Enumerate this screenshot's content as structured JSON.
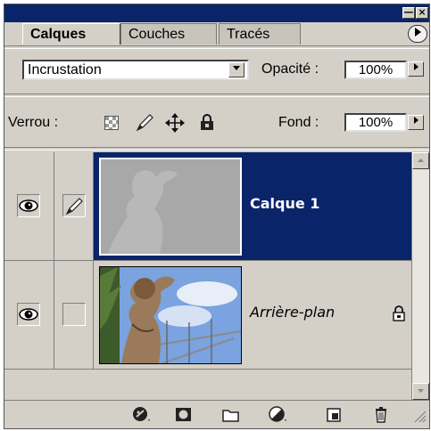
{
  "window": {
    "minimize_glyph": "—",
    "close_glyph": "×"
  },
  "tabs": [
    {
      "label": "Calques",
      "active": true
    },
    {
      "label": "Couches",
      "active": false
    },
    {
      "label": "Tracés",
      "active": false
    }
  ],
  "panel_menu_icon": "panel-menu-arrow-icon",
  "blend": {
    "mode": "Incrustation",
    "opacity_label": "Opacité :",
    "opacity_value": "100%"
  },
  "lock": {
    "label": "Verrou :",
    "icons": [
      "lock-transparency-icon",
      "lock-image-icon",
      "lock-position-icon",
      "lock-all-icon"
    ],
    "fill_label": "Fond :",
    "fill_value": "100%"
  },
  "layers": [
    {
      "name": "Calque 1",
      "selected": true,
      "visible": true,
      "brush_linked": true,
      "locked": false
    },
    {
      "name": "Arrière-plan",
      "selected": false,
      "visible": true,
      "brush_linked": false,
      "locked": true
    }
  ],
  "bottom_icons": [
    "layer-style-icon",
    "layer-mask-icon",
    "new-group-folder-icon",
    "adjustment-layer-icon",
    "new-layer-icon",
    "trash-icon"
  ],
  "colors": {
    "selection": "#0a246a",
    "panel_bg": "#d4d0c8"
  }
}
